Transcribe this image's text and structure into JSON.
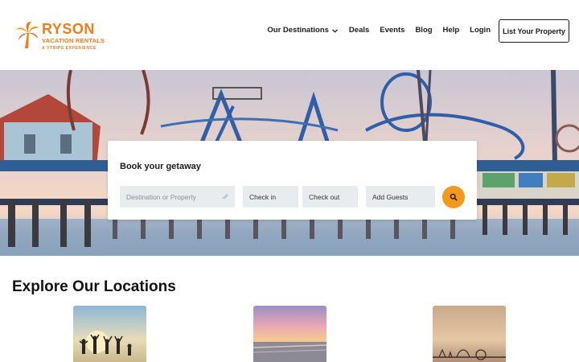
{
  "brand": {
    "name": "RYSON",
    "subtitle": "VACATION RENTALS",
    "tagline": "A VTRIPS EXPERIENCE",
    "color": "#f07c1b"
  },
  "nav": {
    "items": [
      {
        "label": "Our Destinations",
        "has_dropdown": true
      },
      {
        "label": "Deals"
      },
      {
        "label": "Events"
      },
      {
        "label": "Blog"
      },
      {
        "label": "Help"
      },
      {
        "label": "Login"
      }
    ],
    "cta_label": "List Your Property"
  },
  "booking": {
    "title": "Book your getaway",
    "destination_placeholder": "Destination or Property",
    "checkin_label": "Check in",
    "checkout_label": "Check out",
    "guests_label": "Add Guests",
    "search_icon": "search-icon",
    "accent": "#f39a1e"
  },
  "explore": {
    "title": "Explore Our Locations",
    "cards": [
      {
        "image": "beach-friends-silhouette"
      },
      {
        "image": "beach-sunset"
      },
      {
        "image": "pier-sunset"
      }
    ]
  }
}
